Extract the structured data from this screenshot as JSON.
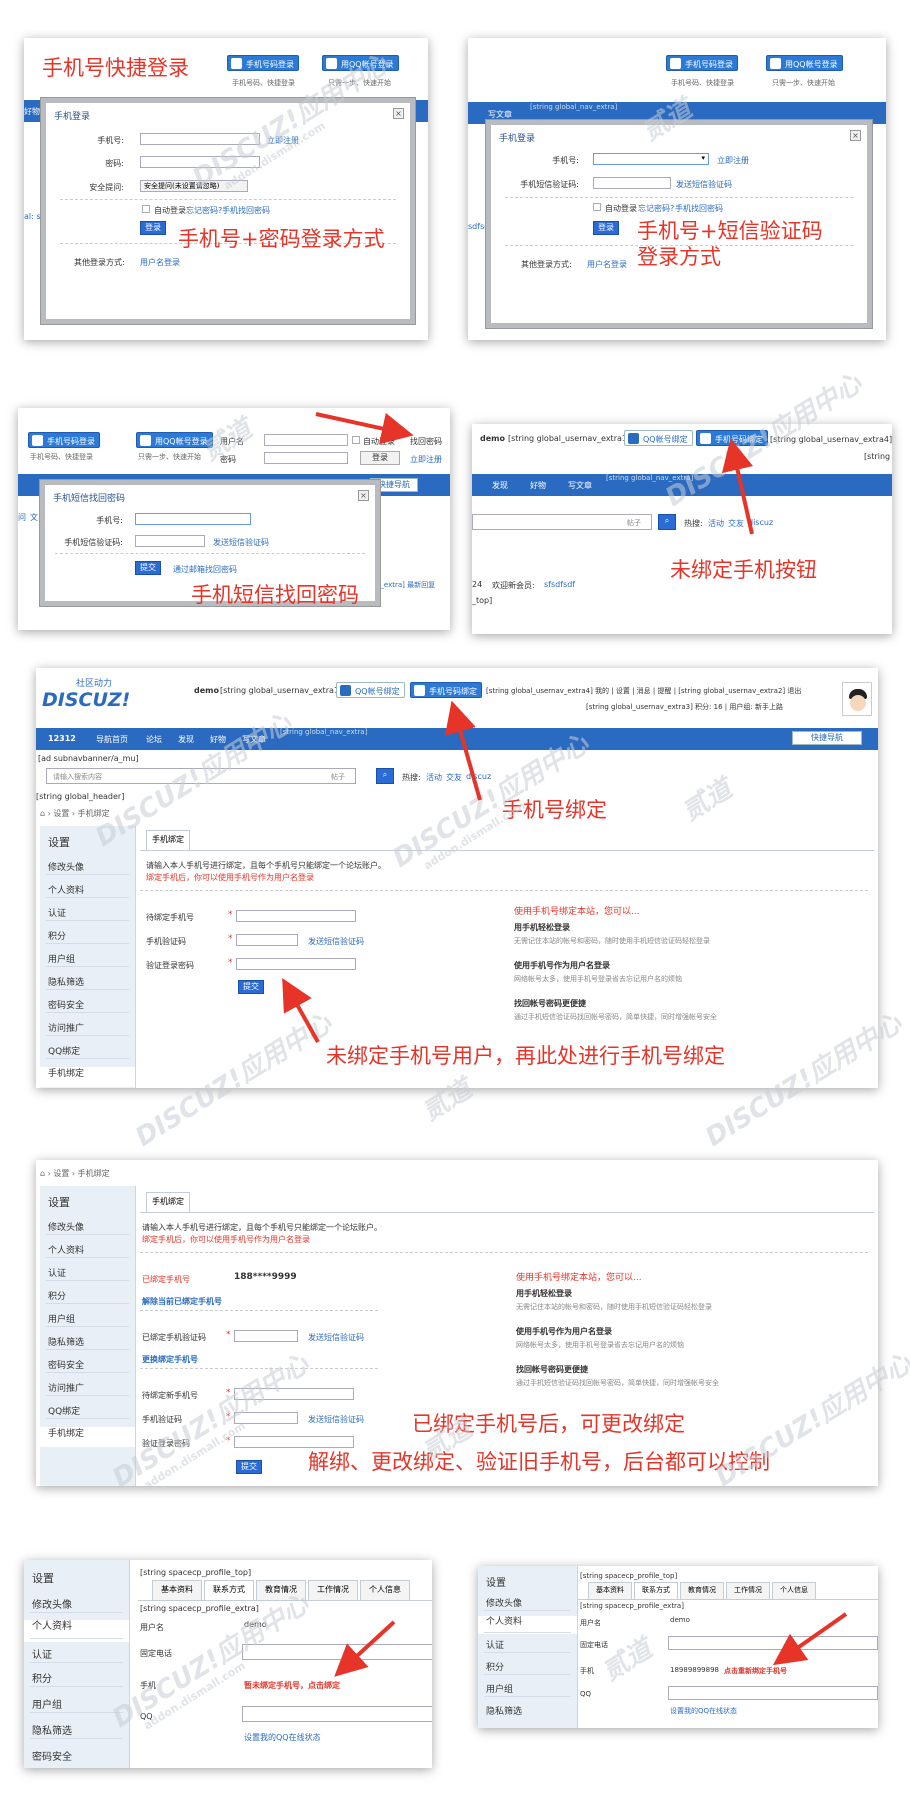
{
  "p1": {
    "title": "手机号快捷登录",
    "btn_phone": "手机号码登录",
    "btn_phone_sub": "手机号码、快捷登录",
    "btn_qq": "用QQ帐号登录",
    "btn_qq_sub": "只需一步、快速开始",
    "nav_left": "好物",
    "modal_title": "手机登录",
    "lbl_phone": "手机号:",
    "lbl_pwd": "密码:",
    "lbl_q": "安全提问:",
    "q_val": "安全提问(未设置请忽略)",
    "reg": "立即注册",
    "auto": "自动登录",
    "forgot": "忘记密码?",
    "find": "手机找回密码",
    "login_btn": "登录",
    "other": "其他登录方式:",
    "other_link": "用户名登录",
    "caption": "手机号+密码登录方式",
    "side_txt": "al: sfs"
  },
  "p2": {
    "btn_phone": "手机号码登录",
    "btn_phone_sub": "手机号码、快捷登录",
    "btn_qq": "用QQ帐号登录",
    "btn_qq_sub": "只需一步、快速开始",
    "nav": "写文章",
    "nav_extra": "[string global_nav_extra]",
    "modal_title": "手机登录",
    "lbl_phone": "手机号:",
    "lbl_sms": "手机短信验证码:",
    "reg": "立即注册",
    "send": "发送短信验证码",
    "auto": "自动登录",
    "forgot": "忘记密码?",
    "find": "手机找回密码",
    "login_btn": "登录",
    "other": "其他登录方式:",
    "other_link": "用户名登录",
    "caption1": "手机号+短信验证码",
    "caption2": "登录方式",
    "side_txt": "sdfsdf"
  },
  "p3": {
    "btn_phone": "手机号码登录",
    "btn_phone_sub": "手机号码、快捷登录",
    "btn_qq": "用QQ帐号登录",
    "btn_qq_sub": "只需一步、快速开始",
    "lbl_user": "用户名",
    "lbl_pwd": "密码",
    "auto": "自动登录",
    "find_pwd": "找回密码",
    "login": "登录",
    "reg": "立即注册",
    "quick": "快捷导航",
    "modal_title": "手机短信找回密码",
    "lbl_phone": "手机号:",
    "lbl_sms": "手机短信验证码:",
    "send": "发送短信验证码",
    "submit": "提交",
    "email_find": "通过邮箱找回密码",
    "caption": "手机短信找回密码",
    "side_a": "问",
    "side_b": "文",
    "extra": "av_extra] 最新回复"
  },
  "p4": {
    "user": "demo",
    "user_extra": "[string global_usernav_extra1]",
    "btn_qq": "QQ帐号绑定",
    "btn_phone": "手机号码绑定",
    "extra4": "[string global_usernav_extra4] 我的",
    "extra_b": "[string g",
    "nav": [
      "发现",
      "好物",
      "写文章"
    ],
    "nav_extra": "[string global_nav_extra]",
    "search_type": "帖子",
    "hot": "热搜:",
    "hot_items": [
      "活动",
      "交友",
      "discuz"
    ],
    "stats": "24",
    "welcome": "欢迎新会员:",
    "newuser": "sfsdfsdf",
    "top": "_top]",
    "caption": "未绑定手机按钮"
  },
  "p5": {
    "brand_top": "社区动力",
    "brand": "DISCUZ!",
    "user": "demo",
    "user_extra": "[string global_usernav_extra1]",
    "btn_qq": "QQ帐号绑定",
    "btn_phone": "手机号码绑定",
    "usernav": "[string global_usernav_extra4] 我的 | 设置 | 消息 | 提醒 | [string global_usernav_extra2] 退出",
    "usernav2": "[string global_usernav_extra3]  积分: 16  | 用户组: 新手上路",
    "nav": [
      "12312",
      "导航首页",
      "论坛",
      "发现",
      "好物",
      "写文章"
    ],
    "nav_extra": "[string global_nav_extra]",
    "quick": "快捷导航",
    "ad": "[ad subnavbanner/a_mu]",
    "search_ph": "请输入搜索内容",
    "search_type": "帖子",
    "hot": "热搜:",
    "hot_items": [
      "活动",
      "交友",
      "discuz"
    ],
    "header": "[string global_header]",
    "crumb": [
      "设置",
      "手机绑定"
    ],
    "side_title": "设置",
    "side": [
      "修改头像",
      "个人资料",
      "认证",
      "积分",
      "用户组",
      "隐私筛选",
      "密码安全",
      "访问推广",
      "QQ绑定",
      "手机绑定"
    ],
    "tab": "手机绑定",
    "intro": "请输入本人手机号进行绑定，且每个手机号只能绑定一个论坛账户。",
    "intro_red": "绑定手机后，你可以使用手机号作为用户名登录",
    "f_phone": "待绑定手机号",
    "f_code": "手机验证码",
    "f_code_link": "发送短信验证码",
    "f_pwd": "验证登录密码",
    "submit": "提交",
    "right_title": "使用手机号绑定本站，您可以...",
    "r1": "用手机轻松登录",
    "r1d": "无需记住本站的帐号和密码，随时使用手机短信验证码轻松登录",
    "r2": "使用手机号作为用户名登录",
    "r2d": "网络帐号太多，使用手机号登录省去忘记用户名的烦恼",
    "r3": "找回帐号密码更便捷",
    "r3d": "通过手机短信验证码找回帐号密码，简单快捷，同时增强帐号安全",
    "caption_top": "手机号绑定",
    "caption": "未绑定手机号用户，再此处进行手机号绑定"
  },
  "p6": {
    "crumb": [
      "设置",
      "手机绑定"
    ],
    "side_title": "设置",
    "side": [
      "修改头像",
      "个人资料",
      "认证",
      "积分",
      "用户组",
      "隐私筛选",
      "密码安全",
      "访问推广",
      "QQ绑定",
      "手机绑定"
    ],
    "tab": "手机绑定",
    "intro": "请输入本人手机号进行绑定，且每个手机号只能绑定一个论坛账户。",
    "intro_red": "绑定手机后，你可以使用手机号作为用户名登录",
    "bound_lbl": "已绑定手机号",
    "bound_val": "188****9999",
    "unbind": "解除当前已绑定手机号",
    "old_code": "已绑定手机验证码",
    "send": "发送短信验证码",
    "change": "更换绑定手机号",
    "new_phone": "待绑定新手机号",
    "f_code": "手机验证码",
    "f_pwd": "验证登录密码",
    "submit": "提交",
    "right_title": "使用手机号绑定本站，您可以...",
    "r1": "用手机轻松登录",
    "r1d": "无需记住本站的帐号和密码，随时使用手机短信验证码轻松登录",
    "r2": "使用手机号作为用户名登录",
    "r2d": "网络帐号太多，使用手机号登录省去忘记用户名的烦恼",
    "r3": "找回帐号密码更便捷",
    "r3d": "通过手机短信验证码找回帐号密码，简单快捷，同时增强帐号安全",
    "caption1": "已绑定手机号后，可更改绑定",
    "caption2": "解绑、更改绑定、验证旧手机号，后台都可以控制"
  },
  "p7": {
    "side_title": "设置",
    "side": [
      "修改头像",
      "个人资料",
      "认证",
      "积分",
      "用户组",
      "隐私筛选",
      "密码安全"
    ],
    "top": "[string spacecp_profile_top]",
    "tabs": [
      "基本资料",
      "联系方式",
      "教育情况",
      "工作情况",
      "个人信息"
    ],
    "extra": "[string spacecp_profile_extra]",
    "user_lbl": "用户名",
    "user_val": "demo",
    "tel": "固定电话",
    "phone": "手机",
    "phone_val": "暂未绑定手机号，点击绑定",
    "qq": "QQ",
    "qq_link": "设置我的QQ在线状态"
  },
  "p8": {
    "side_title": "设置",
    "side": [
      "修改头像",
      "个人资料",
      "认证",
      "积分",
      "用户组",
      "隐私筛选"
    ],
    "top": "[string spacecp_profile_top]",
    "tabs": [
      "基本资料",
      "联系方式",
      "教育情况",
      "工作情况",
      "个人信息"
    ],
    "extra": "[string spacecp_profile_extra]",
    "user_lbl": "用户名",
    "user_val": "demo",
    "tel": "固定电话",
    "phone": "手机",
    "phone_num": "18989899898",
    "phone_link": "点击重新绑定手机号",
    "qq": "QQ",
    "qq_link": "设置我的QQ在线状态"
  },
  "watermark": {
    "a": "DISCUZ!应用中心",
    "b": "addon.dismall.com",
    "c": "贰道"
  },
  "colors": {
    "accent": "#2a6bc1",
    "red": "#e63428"
  }
}
